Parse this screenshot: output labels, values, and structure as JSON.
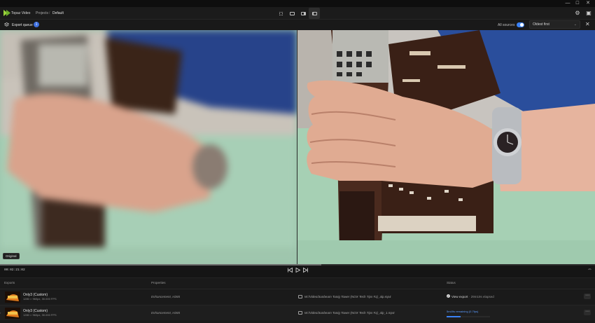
{
  "app": {
    "name": "Topaz Video",
    "breadcrumb": [
      "Projects",
      "Default"
    ],
    "breadcrumb_sep": "/"
  },
  "window_controls": {
    "minimize": "—",
    "maximize": "☐",
    "close": "✕"
  },
  "queue": {
    "title": "Export queue",
    "count": "1",
    "all_sources_label": "All sources",
    "all_sources_on": true,
    "sort_selected": "Oldest first",
    "sort_chevron": "⌄",
    "close": "✕"
  },
  "preview": {
    "original_tag": "Original"
  },
  "timeline": {
    "timecode": "00:02:21:02",
    "progress": 0.54,
    "prev": "◁",
    "play": "▷",
    "next": "▷"
  },
  "table": {
    "headers": {
      "exports": "Exports",
      "properties": "Properties",
      "status": "Status"
    },
    "rows": [
      {
        "name": "Only3 (Custom)",
        "sub": "1280 × 960px, 30.000 FPS",
        "props": "Enhancement, H265",
        "path": "W:/Video/Sunbeam Tunig Tower (NOX Tech Tips #1)_alp.mp4",
        "status_link": "View export",
        "status_meta": "· 29m19s elapsed",
        "state": "done"
      },
      {
        "name": "Only3 (Custom)",
        "sub": "1280 × 960px, 30.000 FPS",
        "props": "Enhancement, H265",
        "path": "W:/Video/Sunbeam Tunig Tower (NOX Tech Tips #1)_alp_1.mp4",
        "status_text": "5m49s remaining (0.7fps)",
        "progress": 0.32,
        "state": "running"
      }
    ],
    "more": "⋯"
  },
  "colors": {
    "accent": "#3b82f6",
    "bg": "#141414",
    "preview_bg": "#9cc4ac"
  }
}
